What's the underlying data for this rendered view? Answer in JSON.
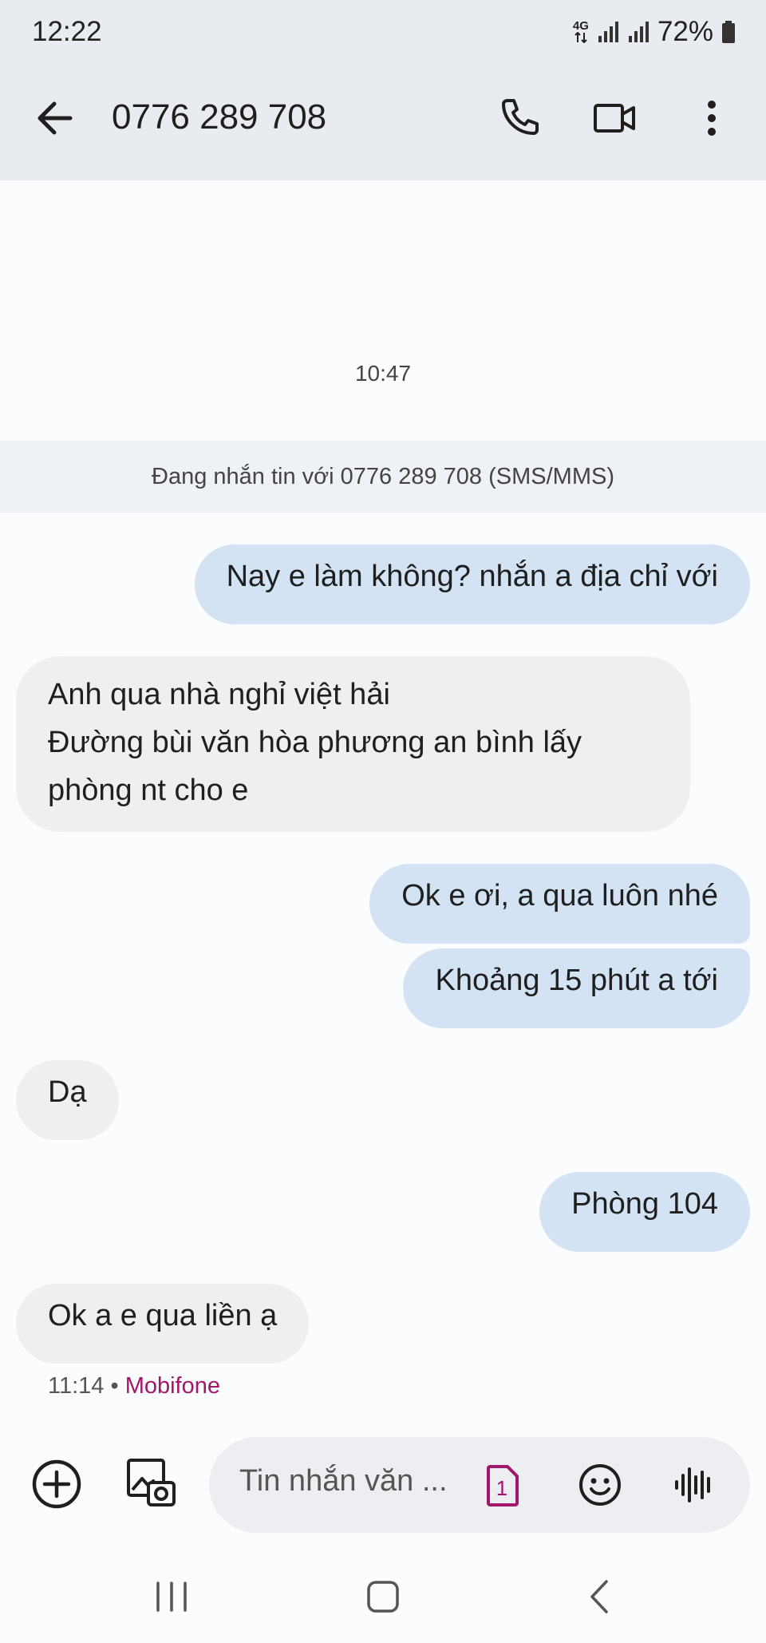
{
  "status_bar": {
    "time": "12:22",
    "network": "4G",
    "battery": "72%"
  },
  "header": {
    "contact": "0776 289 708"
  },
  "conversation": {
    "time_divider": "10:47",
    "banner": "Đang nhắn tin với 0776 289 708 (SMS/MMS)",
    "messages": [
      {
        "dir": "out",
        "text": "Nay e làm không? nhắn a địa chỉ với"
      },
      {
        "dir": "in",
        "lines": [
          "Anh qua nhà nghỉ việt hải",
          "Đường bùi văn hòa phương an bình lấy",
          "phòng nt cho e"
        ]
      },
      {
        "dir": "out",
        "text": "Ok e ơi, a qua luôn nhé"
      },
      {
        "dir": "out",
        "text": "Khoảng 15 phút a tới"
      },
      {
        "dir": "in",
        "text": "Dạ"
      },
      {
        "dir": "out",
        "text": "Phòng 104"
      },
      {
        "dir": "in",
        "text": "Ok a e qua liền ạ"
      }
    ],
    "last_meta": {
      "time": "11:14",
      "separator": "•",
      "carrier": "Mobifone"
    }
  },
  "composer": {
    "placeholder": "Tin nhắn văn ...",
    "sim_slot": "1"
  },
  "colors": {
    "outgoing": "#d3e3f3",
    "incoming": "#eeeff1",
    "carrier": "#a2166b",
    "bar": "#e8ecf1"
  }
}
